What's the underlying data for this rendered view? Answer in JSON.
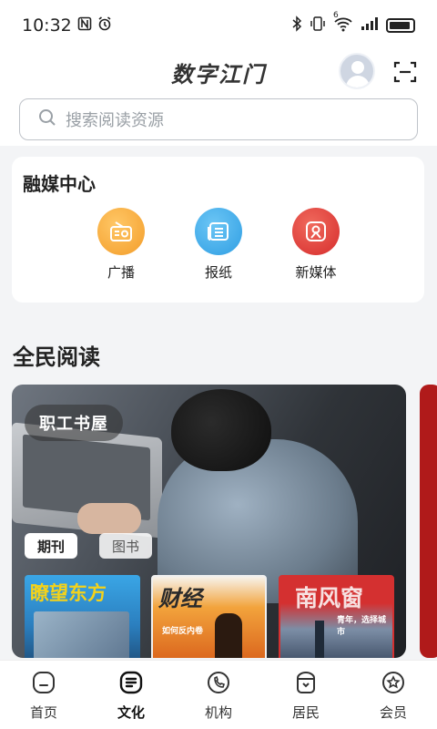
{
  "status_bar": {
    "time": "10:32",
    "icons": [
      "nfc-icon",
      "alarm-icon",
      "bluetooth-icon",
      "vibrate-icon",
      "wifi-icon",
      "signal-icon",
      "battery-icon"
    ],
    "wifi_label": "6"
  },
  "header": {
    "title": "数字江门",
    "search_placeholder": "搜索阅读资源"
  },
  "media_center": {
    "title": "融媒中心",
    "items": [
      {
        "label": "广播",
        "icon": "radio-icon",
        "color": "#f6ad3d"
      },
      {
        "label": "报纸",
        "icon": "newspaper-icon",
        "color": "#38a8e8"
      },
      {
        "label": "新媒体",
        "icon": "new-media-icon",
        "color": "#e0362f"
      }
    ]
  },
  "reading": {
    "section_title": "全民阅读",
    "banner_title": "职工书屋",
    "tabs": [
      "期刊",
      "图书"
    ],
    "magazines": [
      {
        "name": "瞭望东方",
        "color": "#2b97d9",
        "accent": "#f4d21a"
      },
      {
        "name": "财经",
        "subtitle": "如何反内卷",
        "color": "#e9892a",
        "accent": "#ffffff"
      },
      {
        "name": "南风窗",
        "subtitle": "青年，选择城市",
        "color": "#cf2a2a",
        "accent": "#f7e1e1"
      }
    ]
  },
  "bottom_nav": [
    {
      "label": "首页",
      "icon": "home-icon"
    },
    {
      "label": "文化",
      "icon": "culture-icon",
      "active": true
    },
    {
      "label": "机构",
      "icon": "institution-icon"
    },
    {
      "label": "居民",
      "icon": "resident-icon"
    },
    {
      "label": "会员",
      "icon": "member-icon"
    }
  ]
}
